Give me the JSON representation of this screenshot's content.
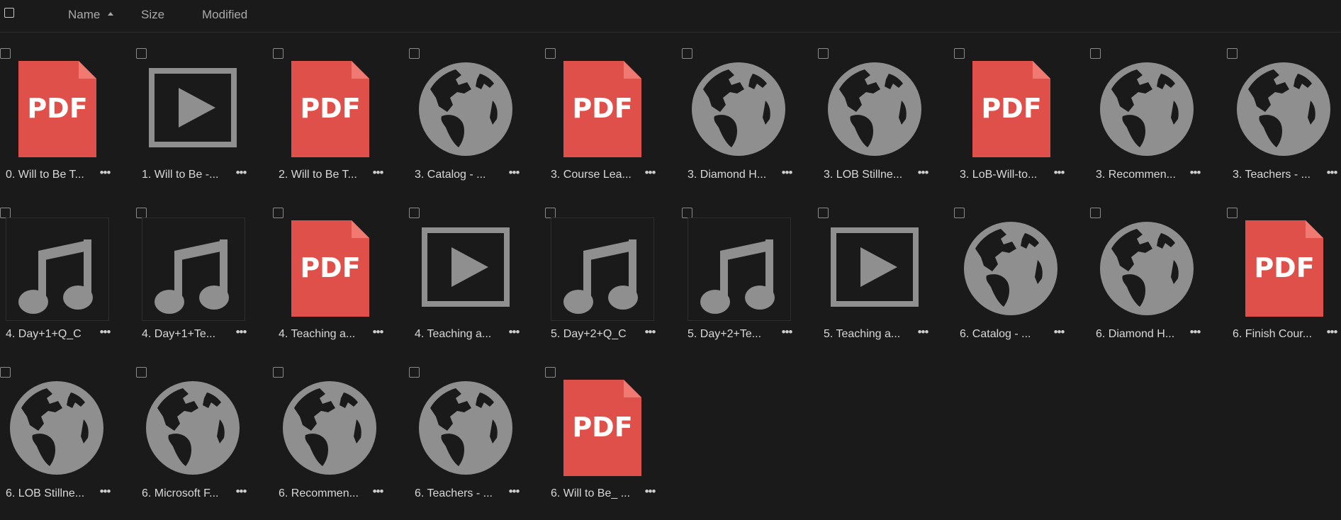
{
  "header": {
    "columns": {
      "name": "Name",
      "size": "Size",
      "modified": "Modified"
    },
    "sort": {
      "column": "name",
      "direction": "ascending"
    }
  },
  "colors": {
    "background": "#1a1a1a",
    "pdf_red": "#e0504a",
    "icon_gray": "#8f8f8f"
  },
  "more_label": "•••",
  "pdf_label": "PDF",
  "files": [
    {
      "name": "0. Will to Be T...",
      "icon": "pdf-icon"
    },
    {
      "name": "1. Will to Be -...",
      "icon": "video-icon"
    },
    {
      "name": "2. Will to Be T...",
      "icon": "pdf-icon"
    },
    {
      "name": "3. Catalog - ...",
      "icon": "globe-icon"
    },
    {
      "name": "3. Course Lea...",
      "icon": "pdf-icon"
    },
    {
      "name": "3. Diamond H...",
      "icon": "globe-icon"
    },
    {
      "name": "3. LOB Stillne...",
      "icon": "globe-icon"
    },
    {
      "name": "3. LoB-Will-to...",
      "icon": "pdf-icon"
    },
    {
      "name": "3. Recommen...",
      "icon": "globe-icon"
    },
    {
      "name": "3. Teachers - ...",
      "icon": "globe-icon"
    },
    {
      "name": "4. Day+1+Q_C",
      "icon": "music-icon"
    },
    {
      "name": "4. Day+1+Te...",
      "icon": "music-icon"
    },
    {
      "name": "4. Teaching a...",
      "icon": "pdf-icon"
    },
    {
      "name": "4. Teaching a...",
      "icon": "video-icon"
    },
    {
      "name": "5. Day+2+Q_C",
      "icon": "music-icon"
    },
    {
      "name": "5. Day+2+Te...",
      "icon": "music-icon"
    },
    {
      "name": "5. Teaching a...",
      "icon": "video-icon"
    },
    {
      "name": "6. Catalog - ...",
      "icon": "globe-icon"
    },
    {
      "name": "6. Diamond H...",
      "icon": "globe-icon"
    },
    {
      "name": "6. Finish Cour...",
      "icon": "pdf-icon"
    },
    {
      "name": "6. LOB Stillne...",
      "icon": "globe-icon"
    },
    {
      "name": "6. Microsoft F...",
      "icon": "globe-icon"
    },
    {
      "name": "6. Recommen...",
      "icon": "globe-icon"
    },
    {
      "name": "6. Teachers - ...",
      "icon": "globe-icon"
    },
    {
      "name": "6. Will to Be_ ...",
      "icon": "pdf-icon"
    }
  ]
}
